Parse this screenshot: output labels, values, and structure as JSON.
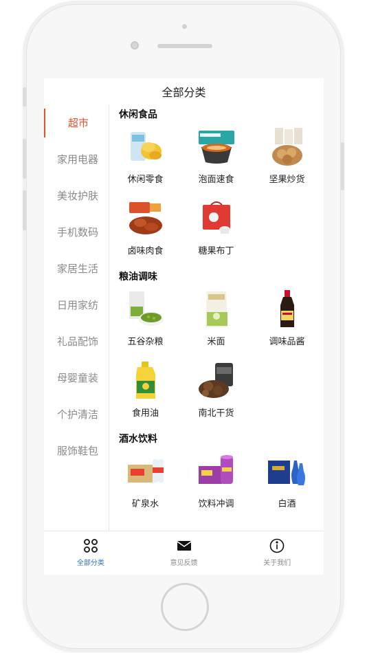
{
  "header": {
    "title": "全部分类"
  },
  "sidebar": {
    "items": [
      {
        "label": "超市",
        "active": true
      },
      {
        "label": "家用电器",
        "active": false
      },
      {
        "label": "美妆护肤",
        "active": false
      },
      {
        "label": "手机数码",
        "active": false
      },
      {
        "label": "家居生活",
        "active": false
      },
      {
        "label": "日用家纺",
        "active": false
      },
      {
        "label": "礼品配饰",
        "active": false
      },
      {
        "label": "母婴童装",
        "active": false
      },
      {
        "label": "个护清洁",
        "active": false
      },
      {
        "label": "服饰鞋包",
        "active": false
      }
    ]
  },
  "sections": [
    {
      "title": "休闲食品",
      "items": [
        {
          "label": "休闲零食",
          "icon": "potato-chips-image"
        },
        {
          "label": "泡面速食",
          "icon": "instant-noodles-image"
        },
        {
          "label": "坚果炒货",
          "icon": "nuts-image"
        },
        {
          "label": "卤味肉食",
          "icon": "braised-meat-image"
        },
        {
          "label": "糖果布丁",
          "icon": "candy-box-image"
        }
      ]
    },
    {
      "title": "粮油调味",
      "items": [
        {
          "label": "五谷杂粮",
          "icon": "mung-beans-image"
        },
        {
          "label": "米面",
          "icon": "rice-bag-image"
        },
        {
          "label": "调味品酱",
          "icon": "soy-sauce-image"
        },
        {
          "label": "食用油",
          "icon": "cooking-oil-image"
        },
        {
          "label": "南北干货",
          "icon": "dried-mushroom-image"
        }
      ]
    },
    {
      "title": "酒水饮料",
      "items": [
        {
          "label": "矿泉水",
          "icon": "mineral-water-image"
        },
        {
          "label": "饮料冲调",
          "icon": "drink-mix-image"
        },
        {
          "label": "白酒",
          "icon": "liquor-image"
        }
      ]
    }
  ],
  "tabbar": {
    "items": [
      {
        "label": "全部分类",
        "icon": "category-grid-icon",
        "active": true
      },
      {
        "label": "意见反馈",
        "icon": "mail-icon",
        "active": false
      },
      {
        "label": "关于我们",
        "icon": "info-icon",
        "active": false
      }
    ]
  },
  "colors": {
    "accent": "#e8522a",
    "tab_active": "#2f6fd6",
    "text_muted": "#8a8a8a"
  }
}
